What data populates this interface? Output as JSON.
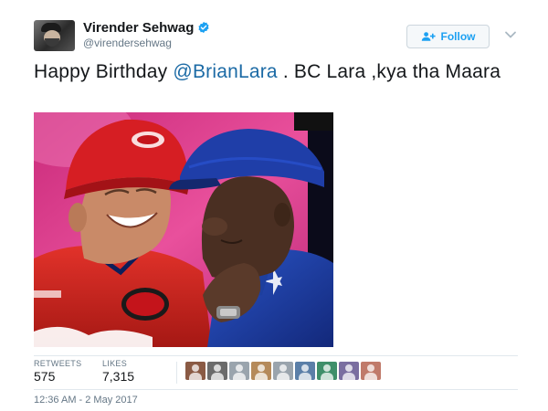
{
  "author": {
    "display_name": "Virender Sehwag",
    "handle": "@virendersehwag"
  },
  "actions": {
    "follow_label": "Follow"
  },
  "tweet": {
    "text_before": "Happy Birthday ",
    "mention": "@BrianLara",
    "text_after": " . BC Lara ,kya tha Maara",
    "timestamp": "12:36 AM - 2 May 2017"
  },
  "stats": {
    "retweets_label": "RETWEETS",
    "retweets_value": "575",
    "likes_label": "LIKES",
    "likes_value": "7,315"
  },
  "likers": [
    {
      "name": "liker-avatar-1",
      "color": "#8a5a44"
    },
    {
      "name": "liker-avatar-2",
      "color": "#6b6b6b"
    },
    {
      "name": "liker-avatar-3",
      "color": "#9aa4ad"
    },
    {
      "name": "liker-avatar-4",
      "color": "#b58a5a"
    },
    {
      "name": "liker-avatar-5",
      "color": "#9aa4ad"
    },
    {
      "name": "liker-avatar-6",
      "color": "#5b7fa8"
    },
    {
      "name": "liker-avatar-7",
      "color": "#3f8f6a"
    },
    {
      "name": "liker-avatar-8",
      "color": "#7a6ea0"
    },
    {
      "name": "liker-avatar-9",
      "color": "#c07a6a"
    }
  ],
  "colors": {
    "accent": "#1da1f2",
    "verified": "#1da1f2",
    "mention": "#1b6aa5",
    "secondary_text": "#657786"
  },
  "icons": {
    "verified": "verified-badge-icon",
    "follow": "add-user-icon",
    "menu": "chevron-down-icon"
  }
}
